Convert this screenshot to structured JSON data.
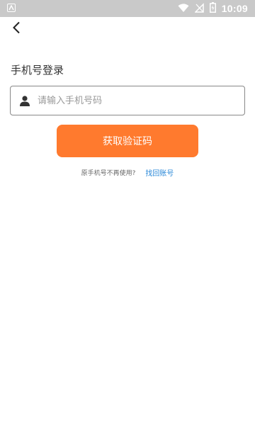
{
  "status_bar": {
    "time": "10:09",
    "icons": [
      "app-notification-icon",
      "wifi-icon",
      "no-sim-icon",
      "battery-charging-icon"
    ]
  },
  "header": {
    "back_icon": "chevron-left-icon"
  },
  "login": {
    "title": "手机号登录",
    "phone_placeholder": "请输入手机号码",
    "phone_value": "",
    "user_icon": "user-icon",
    "get_code_label": "获取验证码",
    "hint": "原手机号不再使用?",
    "recover_label": "找回账号"
  },
  "colors": {
    "status_bar": "#c9c9c9",
    "accent_button": "#ff7a2e",
    "link": "#2a88d8"
  }
}
